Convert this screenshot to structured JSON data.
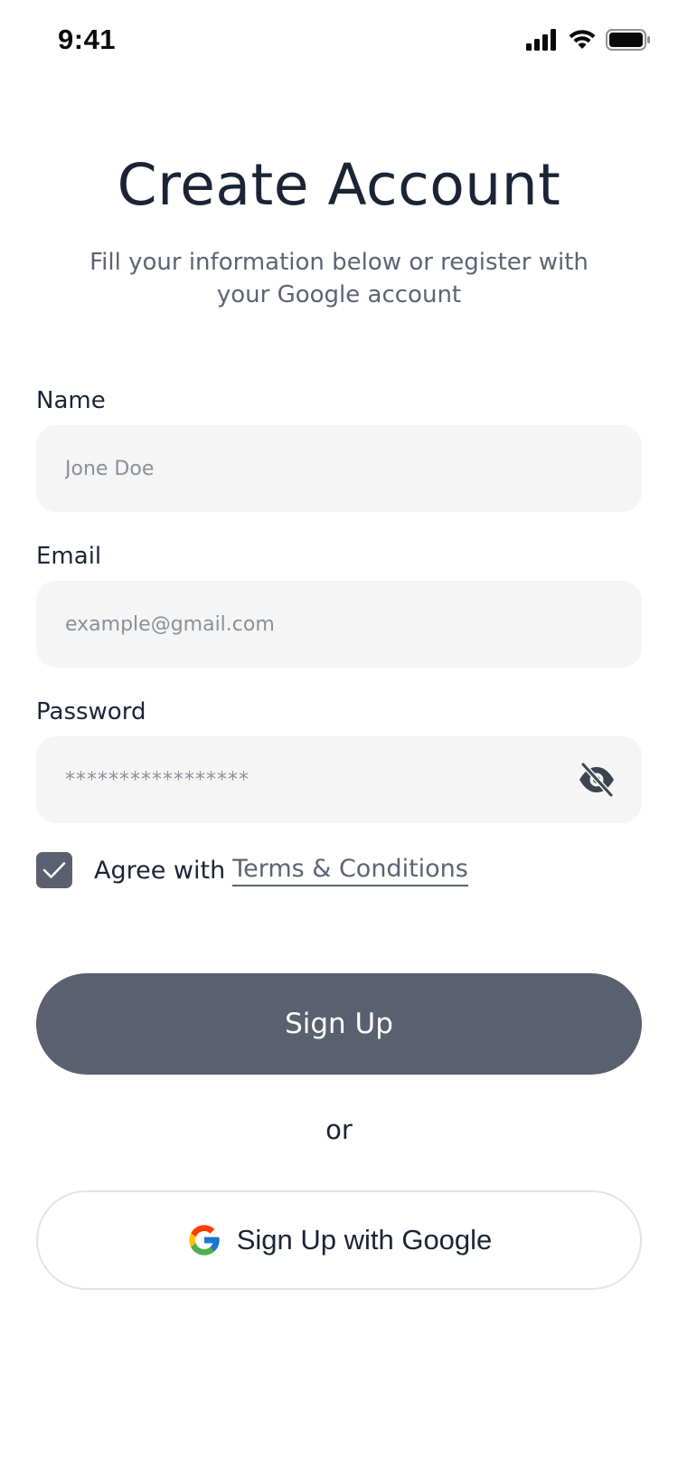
{
  "status_bar": {
    "time": "9:41"
  },
  "header": {
    "title": "Create Account",
    "subtitle": "Fill your information below or register with your Google account"
  },
  "form": {
    "name": {
      "label": "Name",
      "placeholder": "Jone Doe",
      "value": ""
    },
    "email": {
      "label": "Email",
      "placeholder": "example@gmail.com",
      "value": ""
    },
    "password": {
      "label": "Password",
      "value": "*****************",
      "toggle_icon": "eye-off-icon"
    }
  },
  "agree": {
    "checked": true,
    "text": "Agree with",
    "link_text": "Terms & Conditions"
  },
  "actions": {
    "signup_label": "Sign Up",
    "or_label": "or",
    "google_label": "Sign Up with Google"
  },
  "colors": {
    "primary": "#5a6070",
    "text": "#1b2435",
    "muted": "#5c6373",
    "field_bg": "#f5f5f5"
  }
}
